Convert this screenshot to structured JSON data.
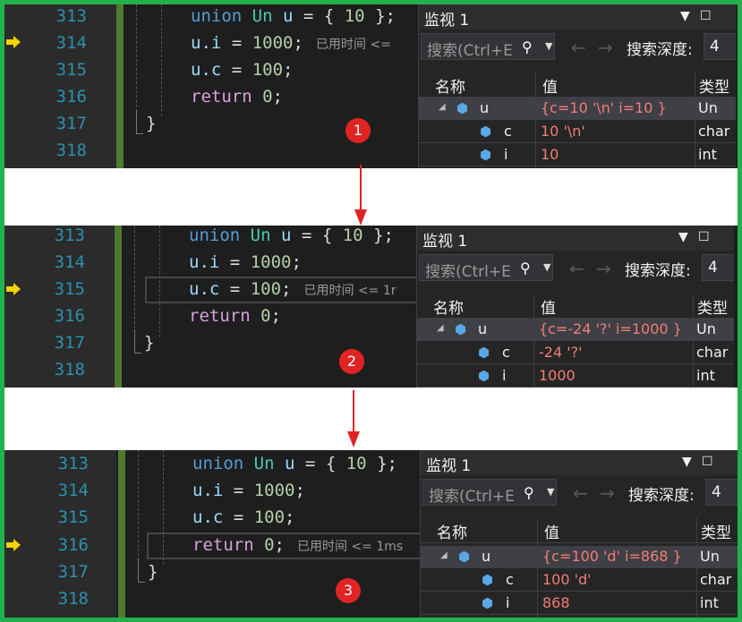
{
  "panels": [
    {
      "lines": [
        "313",
        "314",
        "315",
        "316",
        "317",
        "318"
      ],
      "hint": "已用时间 <= ",
      "badge": "1",
      "watch": {
        "title": "监视 1",
        "search_placeholder": "搜索(Ctrl+E",
        "depth_label": "搜索深度:",
        "depth_value": "4",
        "headers": {
          "name": "名称",
          "value": "值",
          "type": "类型"
        },
        "rows": [
          {
            "name": "u",
            "value": "{c=10 '\\n' i=10 }",
            "type": "Un"
          },
          {
            "name": "c",
            "value": "10 '\\n'",
            "type": "char"
          },
          {
            "name": "i",
            "value": "10",
            "type": "int"
          }
        ]
      }
    },
    {
      "lines": [
        "313",
        "314",
        "315",
        "316",
        "317",
        "318"
      ],
      "hint": "已用时间 <= 1r",
      "badge": "2",
      "watch": {
        "title": "监视 1",
        "search_placeholder": "搜索(Ctrl+E",
        "depth_label": "搜索深度:",
        "depth_value": "4",
        "headers": {
          "name": "名称",
          "value": "值",
          "type": "类型"
        },
        "rows": [
          {
            "name": "u",
            "value": "{c=-24 '?' i=1000 }",
            "type": "Un"
          },
          {
            "name": "c",
            "value": "-24 '?'",
            "type": "char"
          },
          {
            "name": "i",
            "value": "1000",
            "type": "int"
          }
        ]
      }
    },
    {
      "lines": [
        "313",
        "314",
        "315",
        "316",
        "317",
        "318"
      ],
      "hint": "已用时间 <= 1ms",
      "badge": "3",
      "watch": {
        "title": "监视 1",
        "search_placeholder": "搜索(Ctrl+E",
        "depth_label": "搜索深度:",
        "depth_value": "4",
        "headers": {
          "name": "名称",
          "value": "值",
          "type": "类型"
        },
        "rows": [
          {
            "name": "u",
            "value": "{c=100 'd' i=868 }",
            "type": "Un"
          },
          {
            "name": "c",
            "value": "100 'd'",
            "type": "char"
          },
          {
            "name": "i",
            "value": "868",
            "type": "int"
          }
        ]
      }
    }
  ],
  "code": {
    "union_kw": "union",
    "type_name": "Un",
    "var_u": "u",
    "init_eq": "=",
    "init_open": "{",
    "init_val": "10",
    "init_close": "};",
    "ui_stmt": "u.i",
    "ui_eq": "=",
    "ui_val": "1000",
    "semi": ";",
    "uc_stmt": "u.c",
    "uc_eq": "=",
    "uc_val": "100",
    "return_kw": "return",
    "return_val": "0",
    "close_brace": "}"
  },
  "colors": {
    "frame": "#22b14c",
    "badge": "#e02424",
    "value_changed": "#f07f73"
  },
  "icons": {
    "current_statement": "yellow-arrow-icon",
    "watch_item": "cube-icon",
    "search": "search-icon"
  }
}
